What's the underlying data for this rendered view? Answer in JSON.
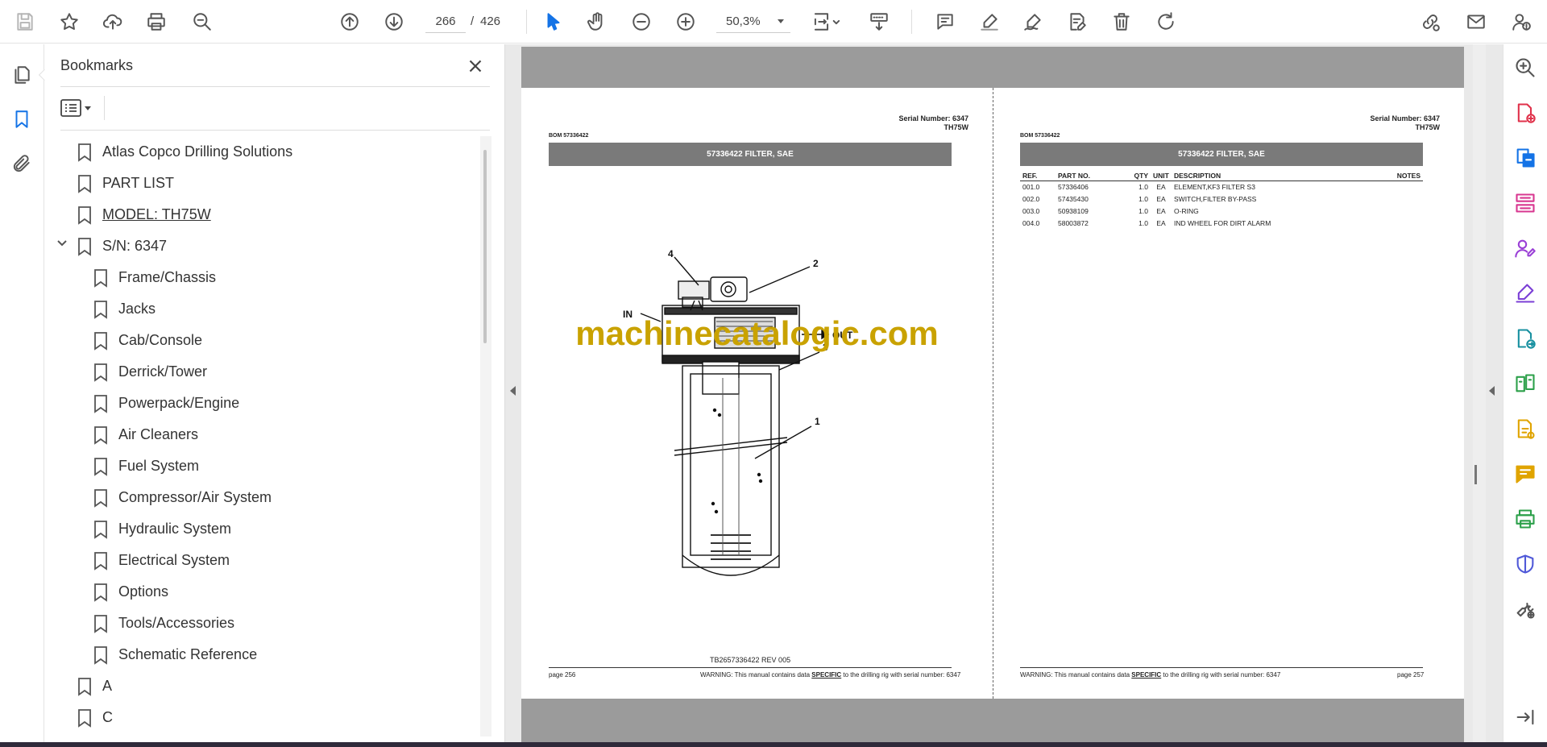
{
  "toolbar": {
    "page_current": "266",
    "page_separator": "/",
    "page_total": "426",
    "zoom": "50,3%"
  },
  "bookmarks": {
    "title": "Bookmarks",
    "items": [
      {
        "label": "Atlas Copco Drilling Solutions"
      },
      {
        "label": "PART LIST"
      },
      {
        "label": "MODEL: TH75W"
      },
      {
        "label": "S/N: 6347"
      },
      {
        "label": "Frame/Chassis"
      },
      {
        "label": "Jacks"
      },
      {
        "label": "Cab/Console"
      },
      {
        "label": "Derrick/Tower"
      },
      {
        "label": "Powerpack/Engine"
      },
      {
        "label": "Air Cleaners"
      },
      {
        "label": "Fuel System"
      },
      {
        "label": "Compressor/Air System"
      },
      {
        "label": "Hydraulic System"
      },
      {
        "label": "Electrical System"
      },
      {
        "label": "Options"
      },
      {
        "label": "Tools/Accessories"
      },
      {
        "label": "Schematic Reference"
      },
      {
        "label": "A"
      },
      {
        "label": "C"
      }
    ]
  },
  "document": {
    "left_page": {
      "serial": "Serial Number: 6347",
      "model": "TH75W",
      "bom": "BOM 57336422",
      "banner": "57336422 FILTER, SAE",
      "rev": "TB2657336422 REV 005",
      "page_label": "page 256",
      "warning_a": "WARNING:  This manual contains data ",
      "warning_b": "SPECIFIC",
      "warning_c": " to the drilling rig with serial number: 6347",
      "callouts": {
        "c1": "1",
        "c2": "2",
        "c3": "3",
        "c4": "4",
        "in": "IN",
        "out": "OUT"
      }
    },
    "right_page": {
      "serial": "Serial Number: 6347",
      "model": "TH75W",
      "bom": "BOM 57336422",
      "banner": "57336422 FILTER, SAE",
      "page_label": "page 257",
      "warning_a": "WARNING:  This manual contains data ",
      "warning_b": "SPECIFIC",
      "warning_c": " to the drilling rig with serial number: 6347",
      "headers": {
        "ref": "REF.",
        "part": "PART NO.",
        "qty": "QTY",
        "unit": "UNIT",
        "desc": "DESCRIPTION",
        "notes": "NOTES"
      },
      "rows": [
        {
          "ref": "001.0",
          "part": "57336406",
          "qty": "1.0",
          "unit": "EA",
          "desc": "ELEMENT,KF3 FILTER S3"
        },
        {
          "ref": "002.0",
          "part": "57435430",
          "qty": "1.0",
          "unit": "EA",
          "desc": "SWITCH,FILTER BY-PASS"
        },
        {
          "ref": "003.0",
          "part": "50938109",
          "qty": "1.0",
          "unit": "EA",
          "desc": "O-RING"
        },
        {
          "ref": "004.0",
          "part": "58003872",
          "qty": "1.0",
          "unit": "EA",
          "desc": "IND WHEEL FOR DIRT ALARM"
        }
      ]
    },
    "watermark": "machinecatalogic.com"
  },
  "icons": {
    "accent": "#1473e6",
    "toolbar": [
      "save-icon",
      "star-icon",
      "upload-icon",
      "print-icon",
      "zoom-search-icon",
      "page-up-icon",
      "page-down-icon",
      "select-cursor-icon",
      "hand-icon",
      "zoom-out-icon",
      "zoom-in-icon",
      "fit-page-icon",
      "scroll-mode-icon",
      "comment-icon",
      "highlight-icon",
      "sign-icon",
      "edit-text-icon",
      "delete-icon",
      "rotate-icon",
      "share-link-icon",
      "email-icon",
      "account-icon"
    ]
  }
}
